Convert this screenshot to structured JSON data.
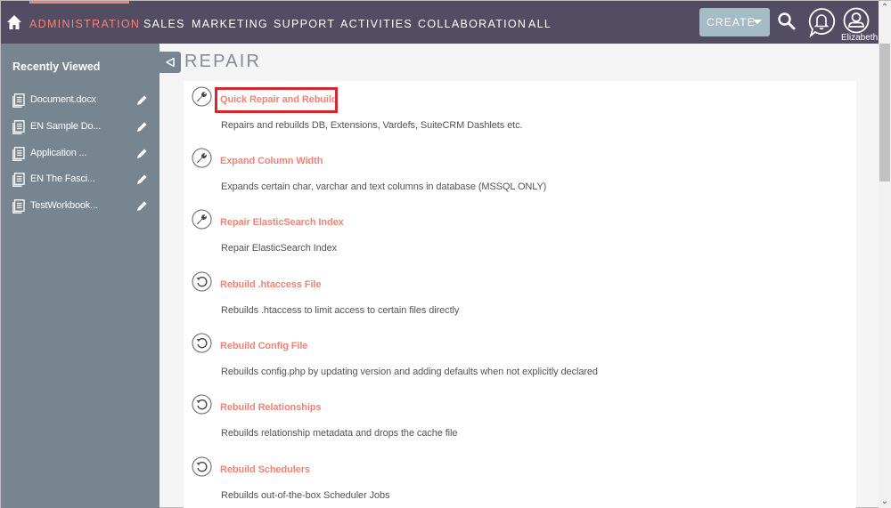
{
  "topnav": {
    "home_icon": "home-icon",
    "items": [
      {
        "label": "ADMINISTRATION",
        "active": true
      },
      {
        "label": "SALES",
        "active": false
      },
      {
        "label": "MARKETING",
        "active": false
      },
      {
        "label": "SUPPORT",
        "active": false
      },
      {
        "label": "ACTIVITIES",
        "active": false
      },
      {
        "label": "COLLABORATION",
        "active": false
      },
      {
        "label": "ALL",
        "active": false
      }
    ],
    "create_label": "CREATE",
    "search_icon": "search-icon",
    "notifications_icon": "bell-icon",
    "user_icon": "user-icon",
    "user_name": "Elizabeth"
  },
  "sidebar": {
    "title": "Recently Viewed",
    "items": [
      {
        "label": "Document.docx"
      },
      {
        "label": "EN Sample Do..."
      },
      {
        "label": "Application ..."
      },
      {
        "label": "EN The Fasci..."
      },
      {
        "label": "TestWorkbook..."
      }
    ]
  },
  "page": {
    "title": "REPAIR",
    "items": [
      {
        "title": "Quick Repair and Rebuild",
        "description": "Repairs and rebuilds DB, Extensions, Vardefs, SuiteCRM Dashlets etc.",
        "icon": "wrench-icon",
        "highlighted": true
      },
      {
        "title": "Expand Column Width",
        "description": "Expands certain char, varchar and text columns in database (MSSQL ONLY)",
        "icon": "wrench-icon",
        "highlighted": false
      },
      {
        "title": "Repair ElasticSearch Index",
        "description": "Repair ElasticSearch Index",
        "icon": "wrench-icon",
        "highlighted": false
      },
      {
        "title": "Rebuild .htaccess File",
        "description": "Rebuilds .htaccess to limit access to certain files directly",
        "icon": "rebuild-icon",
        "highlighted": false
      },
      {
        "title": "Rebuild Config File",
        "description": "Rebuilds config.php by updating version and adding defaults when not explicitly declared",
        "icon": "rebuild-icon",
        "highlighted": false
      },
      {
        "title": "Rebuild Relationships",
        "description": "Rebuilds relationship metadata and drops the cache file",
        "icon": "rebuild-icon",
        "highlighted": false
      },
      {
        "title": "Rebuild Schedulers",
        "description": "Rebuilds out-of-the-box Scheduler Jobs",
        "icon": "rebuild-icon",
        "highlighted": false
      }
    ]
  },
  "colors": {
    "nav_bg": "#534d64",
    "accent": "#f08377",
    "sidebar_bg": "#778591",
    "create_bg": "#a5bcc6",
    "highlight": "#d9262c"
  }
}
